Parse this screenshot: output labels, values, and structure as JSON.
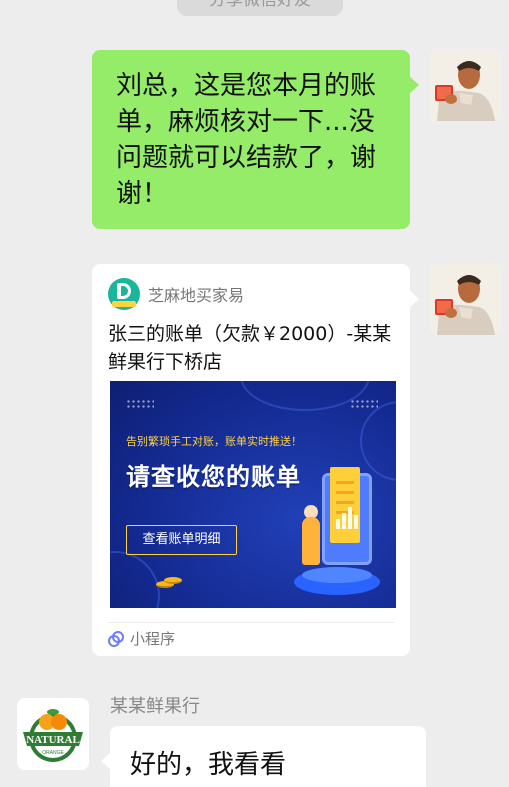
{
  "system_notice": "分享微信好友",
  "messages": {
    "outgoing_text": "刘总，这是您本月的账单，麻烦核对一下...没问题就可以结款了，谢谢！",
    "mini_program_card": {
      "app_name": "芝麻地买家易",
      "title": "张三的账单（欠款￥2000）-某某鲜果行下桥店",
      "banner": {
        "subtitle": "告别繁琐手工对账，账单实时推送！",
        "headline": "请查收您的账单",
        "button": "查看账单明细"
      },
      "footer_label": "小程序"
    },
    "incoming": {
      "sender": "某某鲜果行",
      "text": "好的，我看看",
      "avatar_text": "NATURAL",
      "avatar_subtext": "ORANGE"
    }
  },
  "colors": {
    "background": "#ededed",
    "outgoing_bubble": "#95ec69",
    "incoming_bubble": "#ffffff",
    "banner_blue": "#0d1f7a",
    "banner_accent": "#ffd23f"
  },
  "icons": {
    "self_avatar": "poster-avatar-icon",
    "contact_avatar": "natural-orange-logo-icon",
    "mini_program": "mini-program-link-icon",
    "app_logo": "zhimadi-logo-icon"
  }
}
